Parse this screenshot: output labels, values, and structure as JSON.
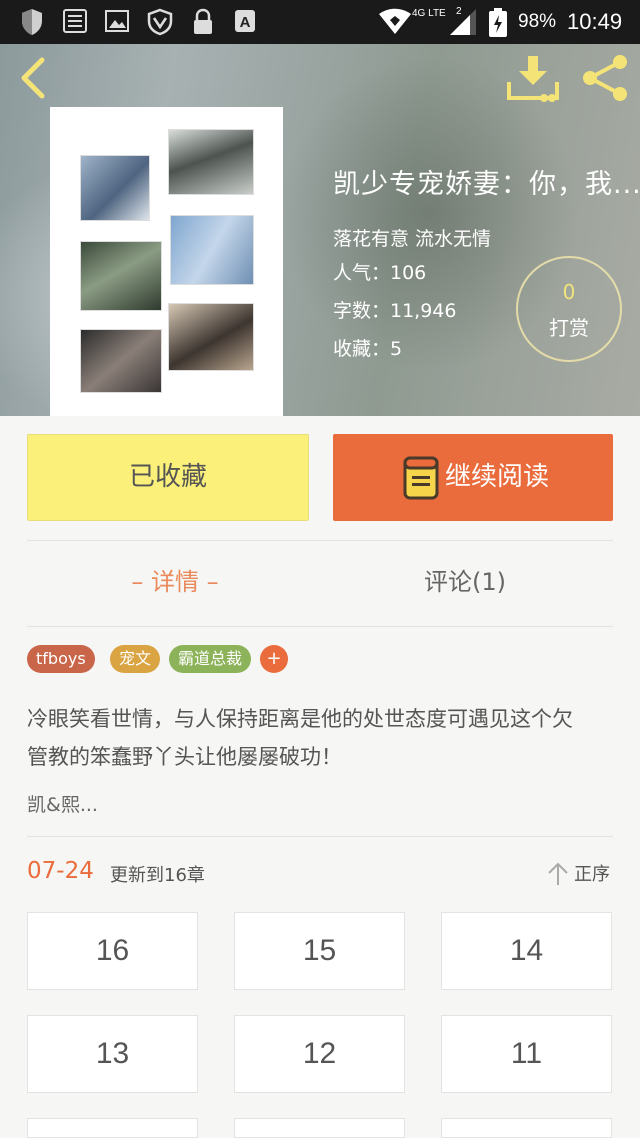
{
  "status_bar": {
    "network": "4G LTE",
    "sim": "2",
    "battery": "98%",
    "time": "10:49"
  },
  "book": {
    "title": "凯少专宠娇妻：你，我...",
    "author": "落花有意 流水无情",
    "popularity_label": "人气：106",
    "word_count_label": "字数：11,946",
    "favorites_label": "收藏：5",
    "reward_count": "0",
    "reward_label": "打赏"
  },
  "actions": {
    "favorited_label": "已收藏",
    "continue_label": "继续阅读"
  },
  "tabs": {
    "detail": "– 详情 –",
    "comments": "评论(1)"
  },
  "tags": [
    {
      "label": "tfboys",
      "color": "#c9664a"
    },
    {
      "label": "宠文",
      "color": "#d9a441"
    },
    {
      "label": "霸道总裁",
      "color": "#8db35a"
    }
  ],
  "tag_add": "+",
  "description": {
    "line1": "冷眼笑看世情，与人保持距离是他的处世态度可遇见这个欠",
    "line2": "管教的笨蠢野丫头让他屡屡破功！",
    "note": "凯&熙..."
  },
  "updates": {
    "date": "07-24",
    "text": "更新到16章",
    "sort_label": "正序"
  },
  "chapters": [
    "16",
    "15",
    "14",
    "13",
    "12",
    "11"
  ],
  "colors": {
    "accent": "#ea6b3c",
    "favorite_button": "#fbf07a",
    "icon_yellow": "#f4e478"
  }
}
